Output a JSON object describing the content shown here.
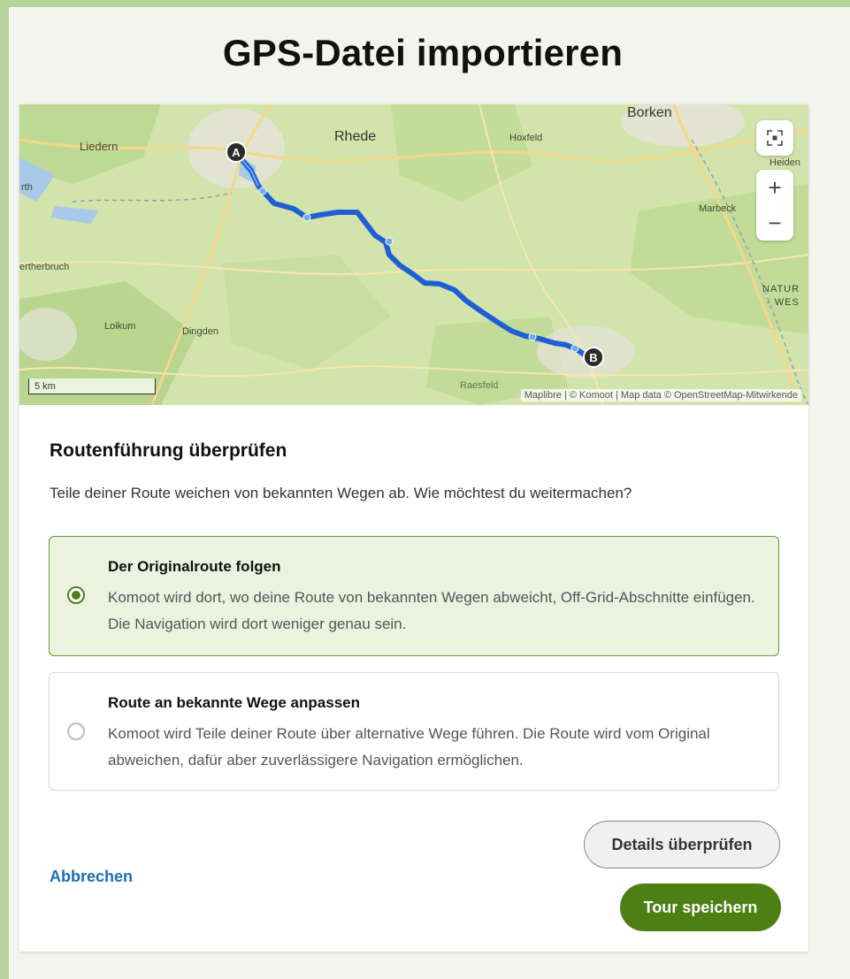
{
  "dialog": {
    "title": "GPS-Datei importieren"
  },
  "map": {
    "labels": {
      "borken": "Borken",
      "rhede": "Rhede",
      "hoxfeld": "Hoxfeld",
      "liedern": "Liedern",
      "heiden": "Heiden",
      "rth": "rth",
      "marbeck": "Marbeck",
      "ertherbruch": "ertherbruch",
      "natur": "NATUR",
      "wes": "- WES",
      "loikum": "Loikum",
      "dingden": "Dingden",
      "raesfeld": "Raesfeld"
    },
    "marker_start": "A",
    "marker_end": "B",
    "scale": "5 km",
    "attribution": "Maplibre | © Komoot | Map data © OpenStreetMap-Mitwirkende",
    "controls": {
      "recenter_icon": "recenter-icon",
      "zoom_in": "+",
      "zoom_out": "−"
    },
    "route_color": "#1f5fd6"
  },
  "review": {
    "heading": "Routenführung überprüfen",
    "description": "Teile deiner Route weichen von bekannten Wegen ab. Wie möchtest du weitermachen?",
    "options": [
      {
        "title": "Der Originalroute folgen",
        "description": "Komoot wird dort, wo deine Route von bekannten Wegen abweicht, Off-Grid-Abschnitte einfügen. Die Navigation wird dort weniger genau sein.",
        "selected": true
      },
      {
        "title": "Route an bekannte Wege anpassen",
        "description": "Komoot wird Teile deiner Route über alternative Wege führen. Die Route wird vom Original abweichen, dafür aber zuverlässigere Navigation ermöglichen.",
        "selected": false
      }
    ]
  },
  "actions": {
    "cancel": "Abbrechen",
    "details": "Details überprüfen",
    "save": "Tour speichern"
  },
  "colors": {
    "accent_green": "#4d7f14",
    "link_blue": "#1b6fb5",
    "outer_background": "#b5d39a"
  }
}
